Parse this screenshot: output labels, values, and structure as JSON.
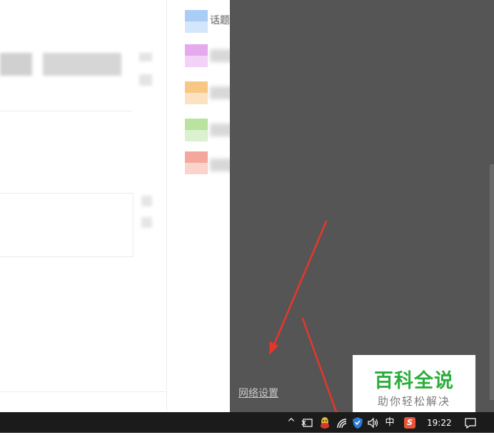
{
  "app": {
    "sidebar_items": [
      {
        "label": "话题",
        "color_top": "#a9cdf5",
        "color_bottom": "#d3e6fb"
      },
      {
        "label": "",
        "color_top": "#e6a9f0",
        "color_bottom": "#f2d3f7"
      },
      {
        "label": "",
        "color_top": "#f7c783",
        "color_bottom": "#fbe3c2"
      },
      {
        "label": "",
        "color_top": "#b9e39e",
        "color_bottom": "#dcf1cf"
      },
      {
        "label": "",
        "color_top": "#f4a79b",
        "color_bottom": "#fad3cd"
      }
    ]
  },
  "flyout": {
    "network_settings_label": "网络设置",
    "background": "#555555"
  },
  "watermark": {
    "title": "百科全说",
    "subtitle": "助你轻松解决"
  },
  "taskbar": {
    "icons": [
      "chevron-up-icon",
      "network-adapter-icon",
      "qq-icon",
      "wifi-icon",
      "shield-icon",
      "volume-icon",
      "ime-icon",
      "sogou-icon",
      "notification-icon"
    ],
    "ime_label": "中",
    "sogou_label": "S",
    "chevron_glyph": "^",
    "volume_glyph": "🔈",
    "clock": "19:22"
  },
  "annotation_color": "#e8362a"
}
